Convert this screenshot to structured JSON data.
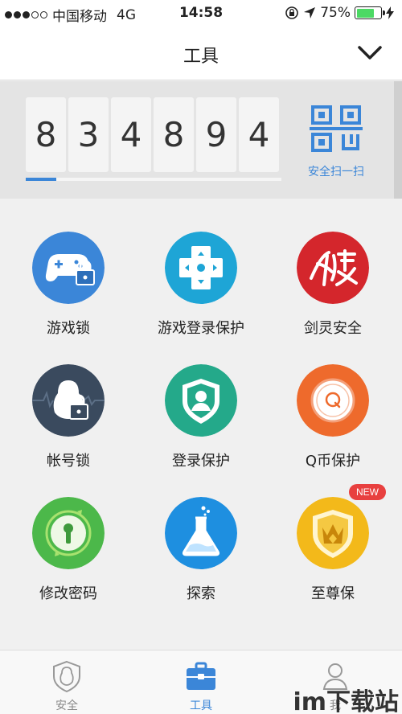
{
  "status_bar": {
    "carrier": "中国移动",
    "network": "4G",
    "time": "14:58",
    "battery_percent": "75%",
    "battery_level": 0.75
  },
  "header": {
    "title": "工具"
  },
  "token": {
    "digits": [
      "8",
      "3",
      "4",
      "8",
      "9",
      "4"
    ],
    "progress": 0.12,
    "scan_label": "安全扫一扫"
  },
  "tools": [
    {
      "label": "游戏锁",
      "icon": "game-lock-icon",
      "color": "#3b86d8"
    },
    {
      "label": "游戏登录保护",
      "icon": "gamepad-icon",
      "color": "#1ea5d6"
    },
    {
      "label": "剑灵安全",
      "icon": "blade-soul-icon",
      "color": "#d4262c"
    },
    {
      "label": "帐号锁",
      "icon": "account-lock-icon",
      "color": "#3a4a5e"
    },
    {
      "label": "登录保护",
      "icon": "login-shield-icon",
      "color": "#24a98a"
    },
    {
      "label": "Q币保护",
      "icon": "q-coin-icon",
      "color": "#ee6a2c"
    },
    {
      "label": "修改密码",
      "icon": "keyhole-icon",
      "color": "#4cb84a"
    },
    {
      "label": "探索",
      "icon": "flask-icon",
      "color": "#1e8fe0"
    },
    {
      "label": "至尊保",
      "icon": "crown-shield-icon",
      "color": "#f3b91a",
      "badge": "NEW"
    }
  ],
  "tab_bar": {
    "tabs": [
      {
        "label": "安全",
        "icon": "shield-person-icon",
        "active": false
      },
      {
        "label": "工具",
        "icon": "toolbox-icon",
        "active": true
      },
      {
        "label": "我",
        "icon": "person-icon",
        "active": false
      }
    ]
  },
  "watermark": "im下载站",
  "accent_color": "#3b86d8"
}
